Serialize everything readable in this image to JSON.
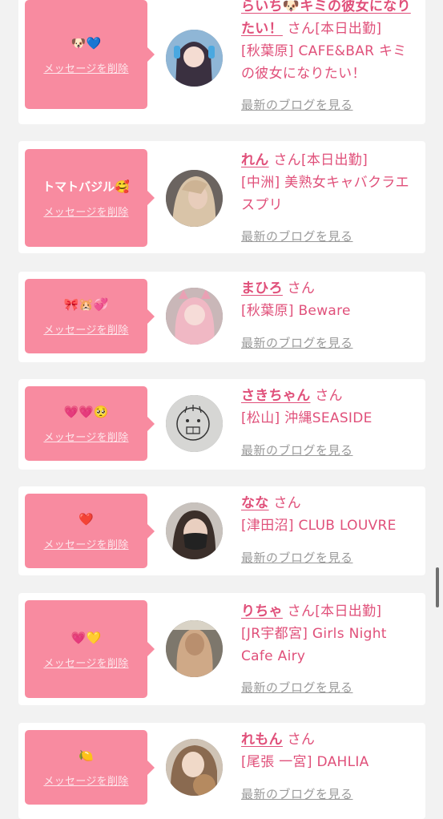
{
  "delete_label": "メッセージを削除",
  "blog_label": "最新のブログを見る",
  "san_label": "さん",
  "colors": {
    "bubble": "#f88ba0",
    "accent": "#e0507a",
    "card": "#ffffff",
    "background": "#f2f2f2"
  },
  "cards": [
    {
      "message": "🐶💙",
      "name": "らいち🐶キミの彼女になりたい！",
      "status": "[本日出勤]",
      "shop": "[秋葉原] CAFE&BAR キミの彼女になりたい！",
      "avatar_icon": "girl-avatar-icon"
    },
    {
      "message": "トマトバジル🥰",
      "name": "れん",
      "status": "[本日出勤]",
      "shop": "[中洲] 美熟女キャバクラエスプリ",
      "avatar_icon": "girl-avatar-icon"
    },
    {
      "message": "🎀🐹💞",
      "name": "まひろ",
      "status": "",
      "shop": "[秋葉原] Beware",
      "avatar_icon": "girl-avatar-icon"
    },
    {
      "message": "💗💗🥺",
      "name": "さきちゃん",
      "status": "",
      "shop": "[松山] 沖縄SEASIDE",
      "avatar_icon": "drawing-avatar-icon"
    },
    {
      "message": "❤️",
      "name": "なな",
      "status": "",
      "shop": "[津田沼] CLUB LOUVRE",
      "avatar_icon": "masked-girl-avatar-icon"
    },
    {
      "message": "💗💛",
      "name": "りちゃ",
      "status": "[本日出勤]",
      "shop": "[JR宇都宮] Girls Night Cafe Airy",
      "avatar_icon": "girl-avatar-icon"
    },
    {
      "message": "🍋",
      "name": "れもん",
      "status": "",
      "shop": "[尾張 一宮] DAHLIA",
      "avatar_icon": "girl-avatar-icon"
    }
  ]
}
